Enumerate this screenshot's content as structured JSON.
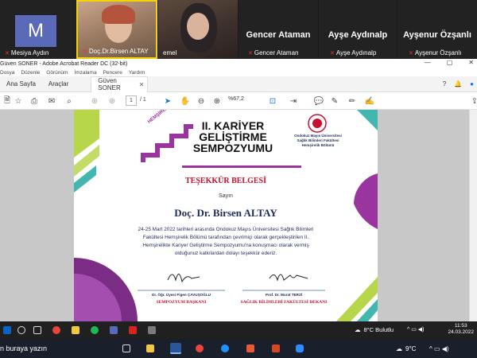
{
  "meeting": {
    "participants": [
      {
        "name": "Mesiya Aydın",
        "initial": "M"
      },
      {
        "name": "Doç.Dr.Birsen ALTAY"
      },
      {
        "name": "emel"
      },
      {
        "name": "Gencer Ataman",
        "display": "Gencer Ataman"
      },
      {
        "name": "Ayşe Aydınalp",
        "display": "Ayşe Aydınalp"
      },
      {
        "name": "Ayşenur Özşanlı",
        "display": "Ayşenur Özşanlı"
      }
    ]
  },
  "acrobat": {
    "window_title": "Güven SONER - Adobe Acrobat Reader DC (32-bit)",
    "menu": [
      "Dosya",
      "Düzenle",
      "Görünüm",
      "İmzalama",
      "Pencere",
      "Yardım"
    ],
    "tabs": {
      "home": "Ana Sayfa",
      "tools": "Araçlar",
      "document": "Güven SONER"
    },
    "page_current": "1",
    "page_total": "/ 1",
    "zoom": "%67,2"
  },
  "certificate": {
    "symposium_prefix": "HEMŞİRELİKTE",
    "symposium_line1": "II. KARİYER",
    "symposium_line2": "GELİŞTİRME",
    "symposium_line3": "SEMPOZYUMU",
    "university_line1": "Ondokuz Mayıs Üniversitesi",
    "university_line2": "Sağlık Bilimleri Fakültesi",
    "university_line3": "Hemşirelik Bölümü",
    "title": "TEŞEKKÜR BELGESİ",
    "salutation": "Sayın",
    "recipient": "Doç. Dr. Birsen ALTAY",
    "body_line1": "24-25 Mart 2022 tarihleri arasında Ondokuz Mayıs Üniversitesi Sağlık Bilimleri",
    "body_line2": "Fakültesi Hemşirelik Bölümü tarafından çevrimiçi olarak gerçekleştirilen II.",
    "body_line3": "Hemşirelikte Kariyer Geliştirme Sempozyumu'na konuşmacı olarak vermiş",
    "body_line4": "olduğunuz katkılardan dolayı teşekkür ederiz.",
    "signer1_name": "Dr. Öğr. Üyesi Figen ÇAVUŞOĞLU",
    "signer1_role": "SEMPOZYUM BAŞKANI",
    "signer2_name": "Prof. Dr. Murat TERZİ",
    "signer2_role": "SAĞLIK BİLİMLERİ FAKÜLTESİ DEKANI"
  },
  "inner_taskbar": {
    "weather": "8°C Bulutlu",
    "time": "11:53",
    "date": "24.03.2022"
  },
  "outer_taskbar": {
    "search": "n buraya yazın",
    "weather": "9°C"
  },
  "colors": {
    "purple": "#9a35a0",
    "green": "#b7d64a",
    "teal": "#41b7b0",
    "red": "#c8102e",
    "navy": "#1f2a5a"
  }
}
